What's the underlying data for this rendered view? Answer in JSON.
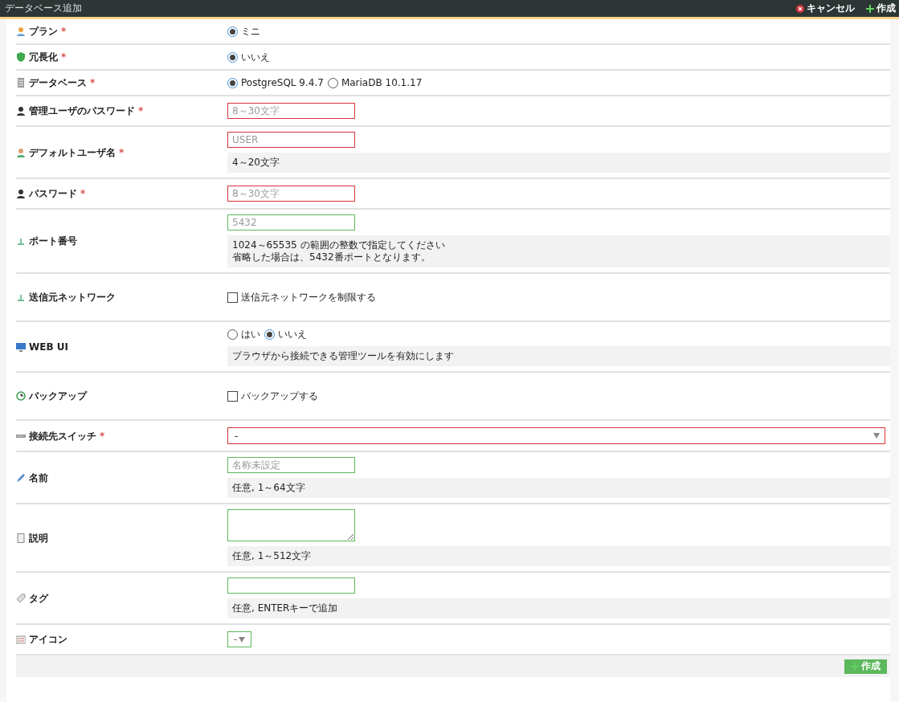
{
  "header": {
    "title": "データベース追加",
    "actions": [
      {
        "kind": "cancel",
        "label": "キャンセル"
      },
      {
        "kind": "create",
        "label": "作成"
      }
    ]
  },
  "rows": [
    {
      "label": "プラン",
      "required": "*",
      "control": {
        "kind": "radio",
        "options": [
          {
            "label": "ミニ",
            "selected": true
          }
        ]
      }
    },
    {
      "label": "冗長化",
      "required": "*",
      "control": {
        "kind": "radio",
        "options": [
          {
            "label": "いいえ",
            "selected": true
          }
        ]
      }
    },
    {
      "label": "データベース",
      "required": "*",
      "control": {
        "kind": "radio",
        "options": [
          {
            "label": "PostgreSQL 9.4.7",
            "selected": true
          },
          {
            "label": "MariaDB 10.1.17",
            "selected": false
          }
        ]
      }
    },
    {
      "label": "管理ユーザのパスワード",
      "required": "*",
      "control": {
        "kind": "input",
        "placeholder": "8～30文字",
        "valid": false
      }
    },
    {
      "label": "デフォルトユーザ名",
      "required": "*",
      "control": {
        "kind": "input",
        "placeholder": "USER",
        "valid": false
      },
      "help": [
        "4～20文字"
      ]
    },
    {
      "label": "パスワード",
      "required": "*",
      "control": {
        "kind": "input",
        "placeholder": "8～30文字",
        "valid": false
      }
    },
    {
      "label": "ポート番号",
      "control": {
        "kind": "input",
        "placeholder": "5432",
        "valid": true
      },
      "help": [
        "1024～65535 の範囲の整数で指定してください",
        "省略した場合は、5432番ポートとなります。"
      ]
    },
    {
      "label": "送信元ネットワーク",
      "control": {
        "kind": "checkbox",
        "label": "送信元ネットワークを制限する",
        "checked": false
      }
    },
    {
      "label": "WEB UI",
      "control": {
        "kind": "radio",
        "options": [
          {
            "label": "はい",
            "selected": false
          },
          {
            "label": "いいえ",
            "selected": true
          }
        ]
      },
      "help": [
        "ブラウザから接続できる管理ツールを有効にします"
      ]
    },
    {
      "label": "バックアップ",
      "control": {
        "kind": "checkbox",
        "label": "バックアップする",
        "checked": false
      }
    },
    {
      "label": "接続先スイッチ",
      "required": "*",
      "control": {
        "kind": "select",
        "value": "-",
        "valid": false
      }
    },
    {
      "label": "名前",
      "control": {
        "kind": "input",
        "placeholder": "名称未設定",
        "valid": true
      },
      "help": [
        "任意, 1～64文字"
      ]
    },
    {
      "label": "説明",
      "control": {
        "kind": "textarea",
        "valid": true
      },
      "help": [
        "任意, 1～512文字"
      ]
    },
    {
      "label": "タグ",
      "control": {
        "kind": "input",
        "valid": true
      },
      "help": [
        "任意, ENTERキーで追加"
      ]
    },
    {
      "label": "アイコン",
      "control": {
        "kind": "iconselect",
        "value": "-"
      }
    }
  ],
  "footer": {
    "button": "作成"
  }
}
